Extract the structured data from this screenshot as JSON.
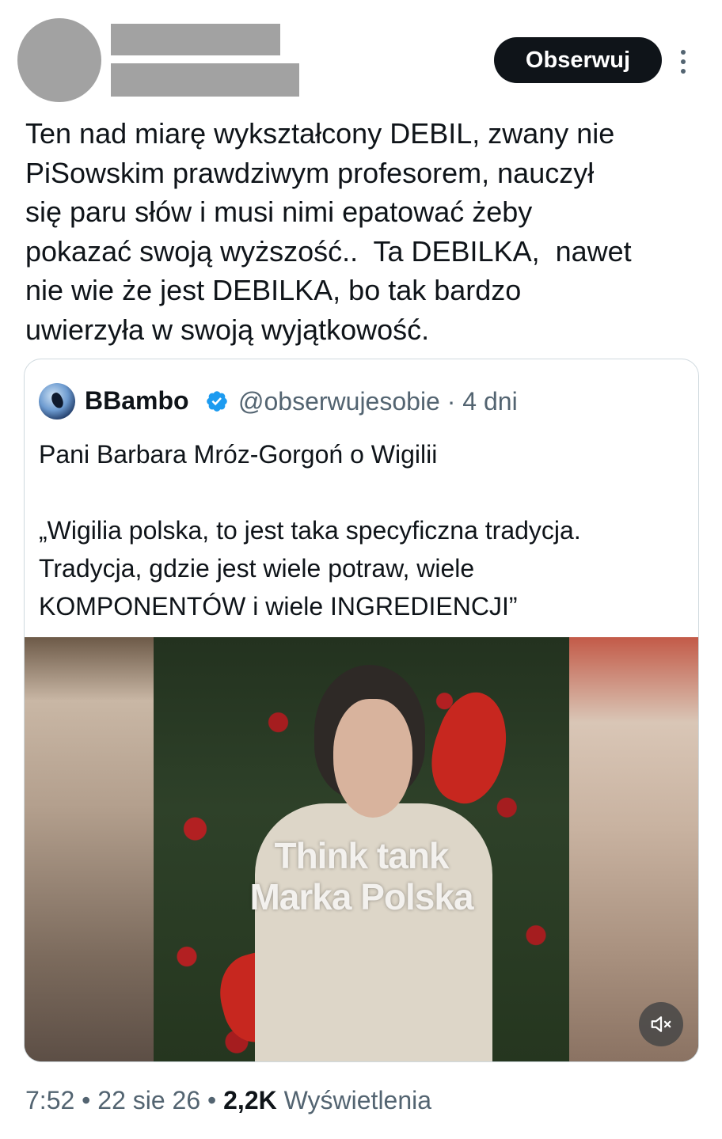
{
  "header": {
    "follow_label": "Obserwuj"
  },
  "tweet": {
    "text": "Ten nad miarę wykształcony DEBIL, zwany nie\nPiSowskim prawdziwym profesorem, nauczył\nsię paru słów i musi nimi epatować żeby\npokazać swoją wyższość..  Ta DEBILKA,  nawet\nnie wie że jest DEBILKA, bo tak bardzo\nuwierzyła w swoją wyjątkowość."
  },
  "quote": {
    "name": "BBambo",
    "handle": "@obserwujesobie",
    "separator": "·",
    "age": "4 dni",
    "text": "Pani Barbara Mróz-Gorgoń o Wigilii\n\n„Wigilia polska, to jest taka specyficzna tradycja.\nTradycja, gdzie jest wiele potraw, wiele\nKOMPONENTÓW i wiele INGREDIENCJI”",
    "video_overlay": "Think tank\nMarka Polska"
  },
  "meta": {
    "time": "7:52",
    "dot": "•",
    "date": "22 sie 26",
    "views_count": "2,2K",
    "views_label": "Wyświetlenia"
  },
  "colors": {
    "text": "#0f1419",
    "secondary": "#536471",
    "verified": "#1d9bf0",
    "border": "#cfd9de"
  }
}
